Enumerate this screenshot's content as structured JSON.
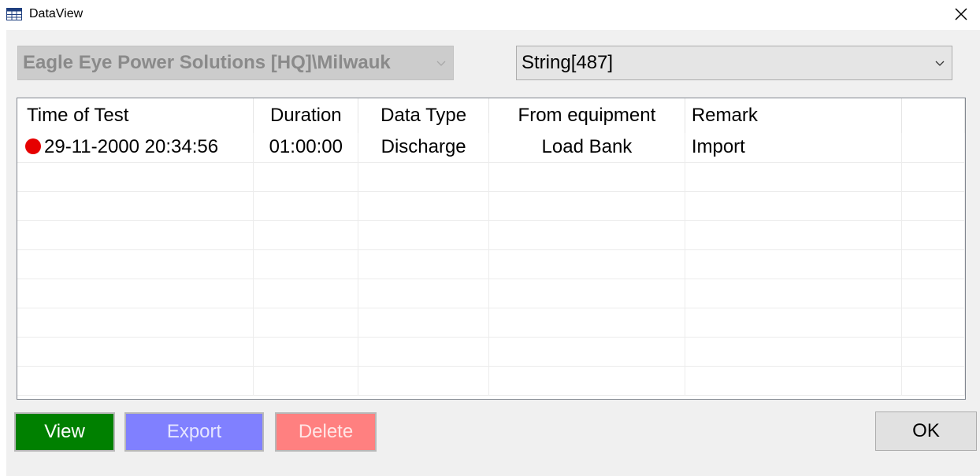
{
  "window": {
    "title": "DataView",
    "icon": "table-icon",
    "close_icon": "close-icon"
  },
  "site_combo": {
    "value": "Eagle Eye Power Solutions [HQ]\\Milwauk",
    "disabled": true
  },
  "string_combo": {
    "value": "String[487]"
  },
  "table": {
    "columns": [
      "Time of Test",
      "Duration",
      "Data Type",
      "From equipment",
      "Remark"
    ],
    "rows": [
      {
        "time": "29-11-2000 20:34:56",
        "duration": "01:00:00",
        "type": "Discharge",
        "from": "Load Bank",
        "remark": "Import",
        "status_color": "#e60000"
      }
    ]
  },
  "buttons": {
    "view": "View",
    "export": "Export",
    "delete": "Delete",
    "ok": "OK"
  },
  "colors": {
    "view_bg": "#008000",
    "export_bg": "#8080ff",
    "delete_bg": "#ff8080"
  }
}
